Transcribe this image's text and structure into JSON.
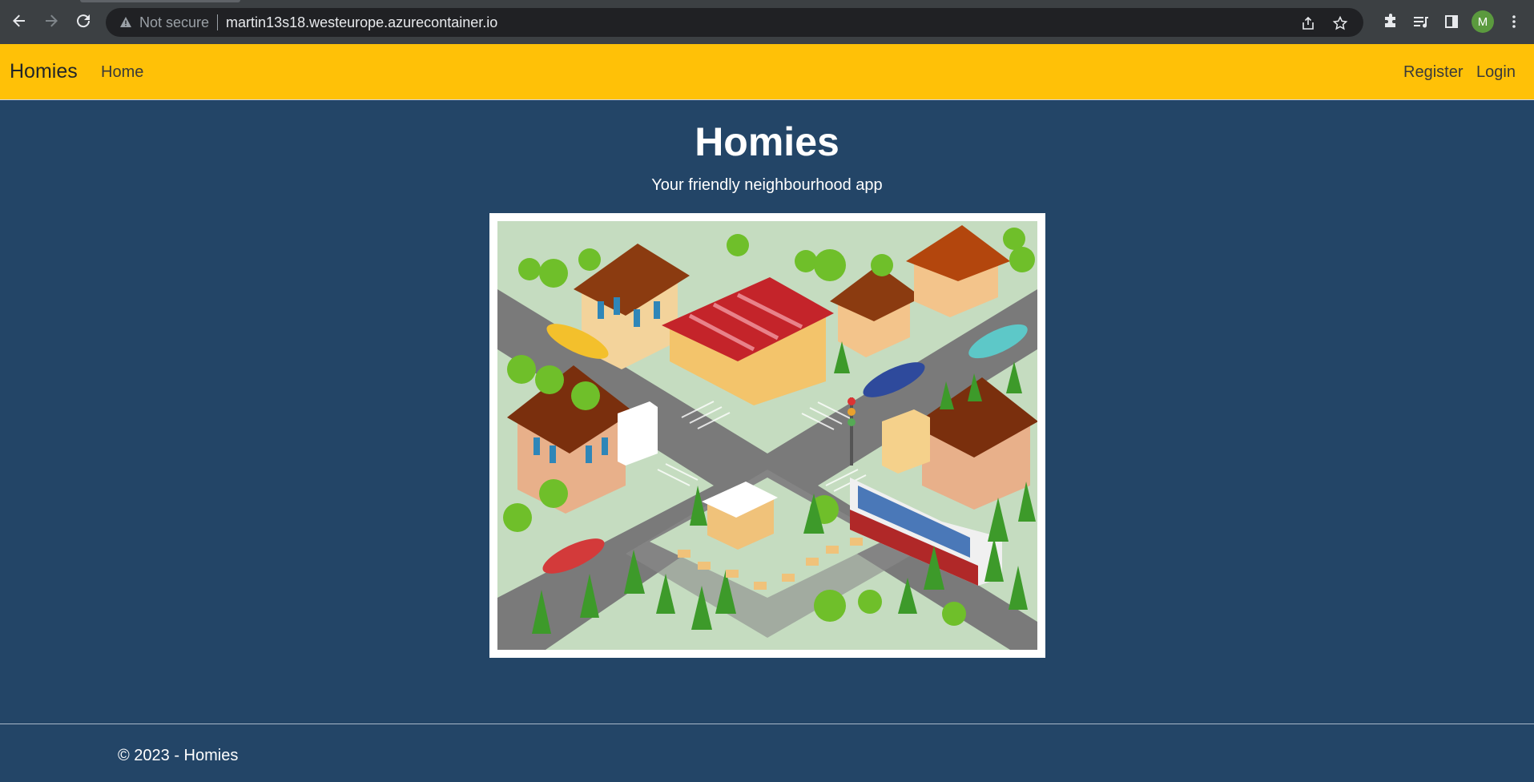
{
  "browser": {
    "security_label": "Not secure",
    "url": "martin13s18.westeurope.azurecontainer.io",
    "profile_initial": "M",
    "icons": [
      "back-arrow-icon",
      "forward-arrow-icon",
      "reload-icon",
      "warning-icon",
      "share-icon",
      "star-icon",
      "extensions-icon",
      "media-icon",
      "side-panel-icon"
    ]
  },
  "navbar": {
    "brand": "Homies",
    "home": "Home",
    "register": "Register",
    "login": "Login",
    "bg_color": "#ffc107"
  },
  "hero": {
    "title": "Homies",
    "subtitle": "Your friendly neighbourhood app",
    "image": "isometric-neighbourhood-illustration"
  },
  "footer": {
    "text": "© 2023 - Homies"
  },
  "colors": {
    "page_bg": "#234567",
    "accent": "#ffc107"
  }
}
